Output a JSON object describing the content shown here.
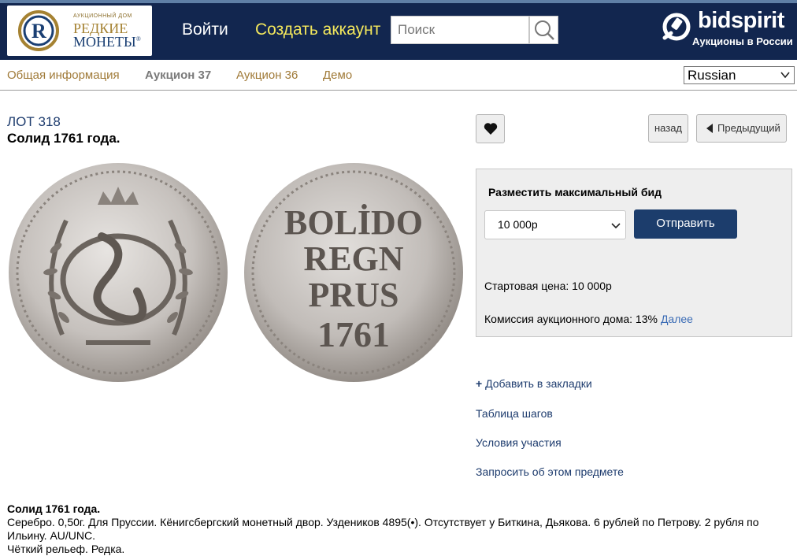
{
  "header": {
    "logo": {
      "small_text": "АУКЦИОННЫЙ ДОМ",
      "line1": "РЕДКИЕ",
      "line2": "МОНЕТЫ",
      "registered": "®"
    },
    "login_label": "Войти",
    "create_account_label": "Создать аккаунт",
    "search": {
      "placeholder": "Поиск",
      "value": ""
    },
    "brand": {
      "name": "bidspirit",
      "tagline": "Аукционы в России"
    }
  },
  "subnav": {
    "items": [
      {
        "label": "Общая информация",
        "active": false
      },
      {
        "label": "Аукцион 37",
        "active": true
      },
      {
        "label": "Аукцион 36",
        "active": false
      },
      {
        "label": "Демо",
        "active": false
      }
    ],
    "language": {
      "selected": "Russian"
    }
  },
  "lot": {
    "number": "ЛОТ 318",
    "title": "Солид 1761 года.",
    "reverse_legend": [
      "BOLİDO",
      "REGN",
      "PRUS",
      "1761"
    ]
  },
  "controls": {
    "back_label": "назад",
    "prev_label": "Предыдущий"
  },
  "bid": {
    "heading": "Разместить максимальный бид",
    "selected_amount": "10 000р",
    "submit_label": "Отправить",
    "start_price_label": "Стартовая цена:",
    "start_price_value": "10 000р",
    "commission_label": "Комиссия аукционного дома: 13%",
    "more_label": "Далее"
  },
  "links": {
    "add_bookmark": "Добавить в закладки",
    "add_bookmark_prefix": "+",
    "steps_table": "Таблица шагов",
    "terms": "Условия участия",
    "ask": "Запросить об этом предмете"
  },
  "description": {
    "title": "Солид 1761 года.",
    "text": "Серебро. 0,50г. Для Пруссии. Кёнигсбергский монетный двор. Уздеников 4895(•). Отсутствует у Биткина, Дьякова. 6 рублей по Петрову. 2 рубля по Ильину. AU/UNC.",
    "note": "Чёткий рельеф. Редка."
  },
  "colors": {
    "header_bg": "#12264f",
    "create_account": "#f3e75c",
    "subnav_link": "#a07a38",
    "accent_button": "#1c3d6c",
    "link_blue": "#1e3c6e"
  }
}
